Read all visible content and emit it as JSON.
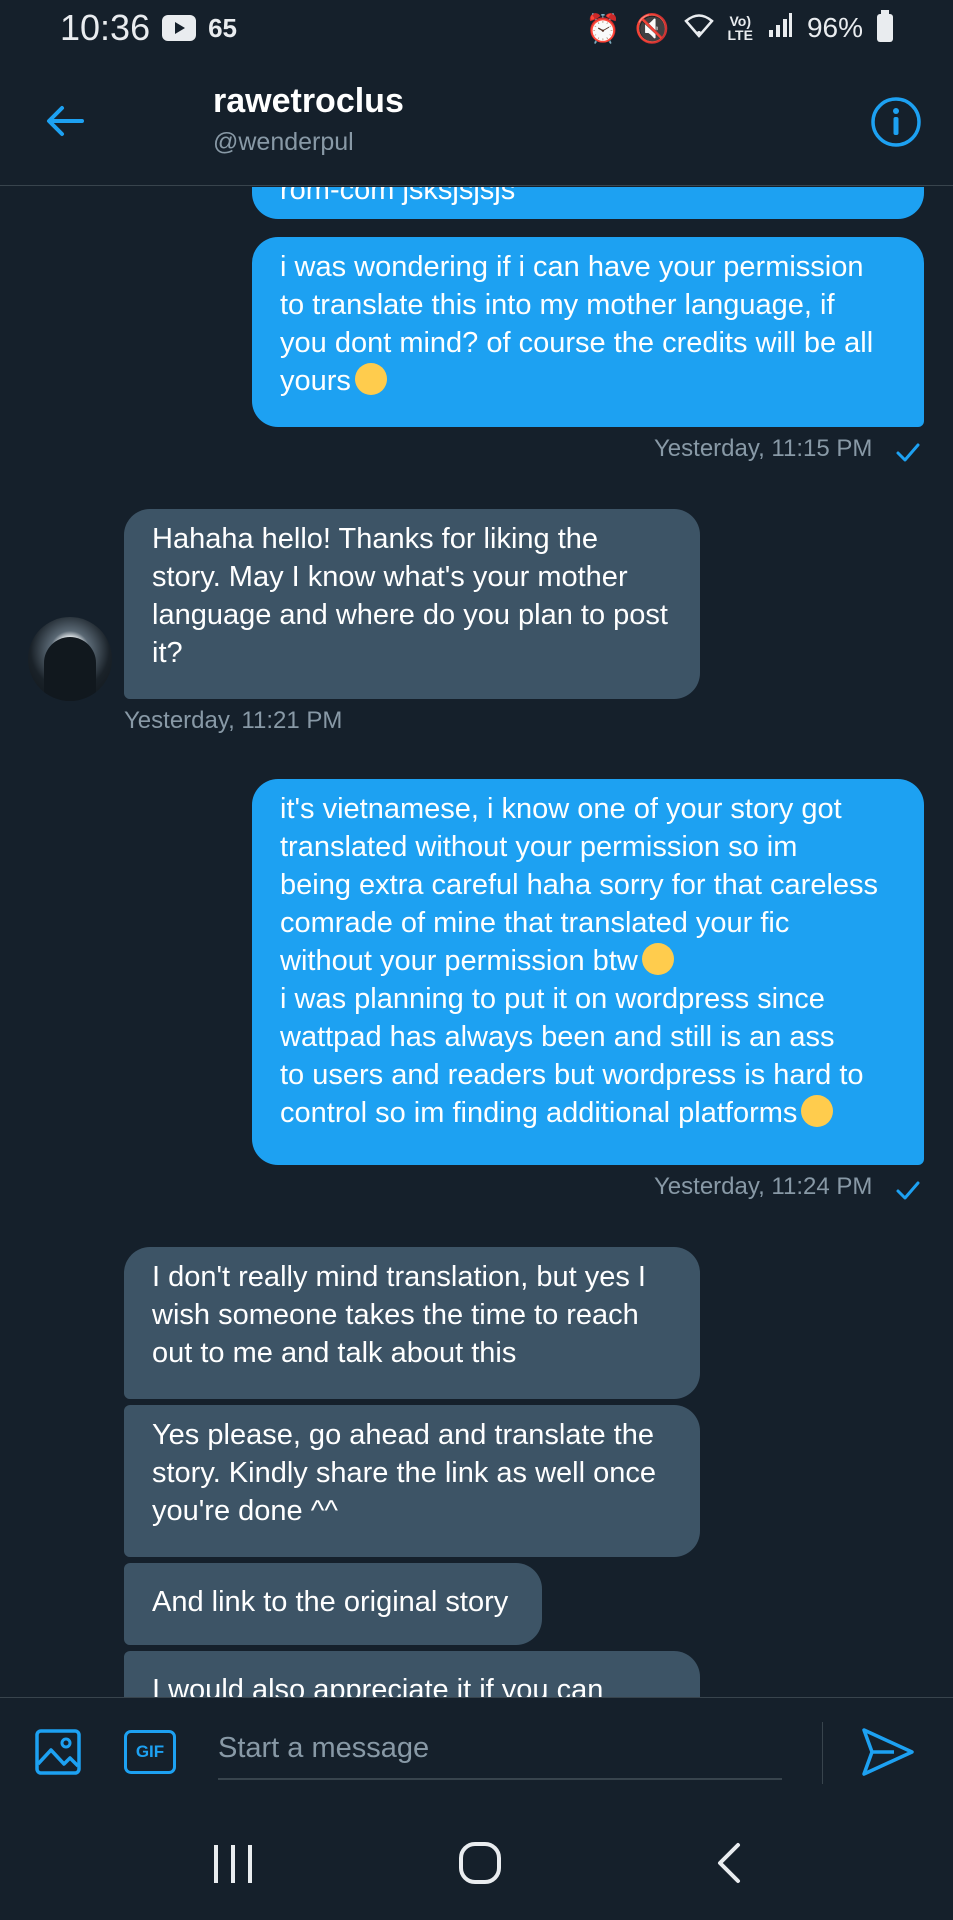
{
  "status_bar": {
    "time": "10:36",
    "notification_count": "65",
    "battery": "96%"
  },
  "header": {
    "name": "rawetroclus",
    "handle": "@wenderpul"
  },
  "messages": [
    {
      "direction": "outgoing",
      "text": "rom-com jsksjsjsjs"
    },
    {
      "direction": "outgoing",
      "lines": [
        "i was wondering if i can have your permission",
        "to translate this into my mother language, if",
        "you dont mind? of course the credits will be all",
        "yours"
      ],
      "emoji": "face-with-rolling-eyes"
    },
    {
      "direction": "outgoing",
      "timestamp": "Yesterday, 11:15 PM"
    },
    {
      "direction": "incoming",
      "lines": [
        "Hahaha hello! Thanks for liking the",
        "story. May I know what's your mother",
        "language and where do you plan to post",
        "it?"
      ],
      "timestamp": "Yesterday, 11:21 PM"
    },
    {
      "direction": "outgoing",
      "lines": [
        "it's vietnamese, i know one of your story got",
        "translated without your permission so im",
        "being extra careful haha sorry for that careless",
        "comrade of mine that translated your fic",
        "without your permission btw",
        "i was planning to put it on wordpress since",
        "wattpad has always been and still is an ass",
        "to users and readers but wordpress is hard to",
        "control so im finding additional platforms"
      ],
      "emojis": [
        "pensive-face",
        "grimacing-face"
      ],
      "timestamp": "Yesterday, 11:24 PM"
    },
    {
      "direction": "incoming",
      "lines": [
        "I don't really mind translation, but yes I",
        "wish someone takes the time to reach",
        "out to me and talk about this"
      ]
    },
    {
      "direction": "incoming",
      "lines": [
        "Yes please, go ahead and translate the",
        "story. Kindly share the link as well once",
        "you're done ^^"
      ]
    },
    {
      "direction": "incoming",
      "lines": [
        "And link to the original story"
      ]
    },
    {
      "direction": "incoming",
      "lines": [
        "I would also appreciate it if you can"
      ]
    }
  ],
  "compose": {
    "placeholder": "Start a message",
    "gif_label": "GIF"
  },
  "colors": {
    "background": "#15202b",
    "accent": "#1da1f2",
    "incoming_bubble": "#3d5466",
    "secondary_text": "#8899a6"
  }
}
